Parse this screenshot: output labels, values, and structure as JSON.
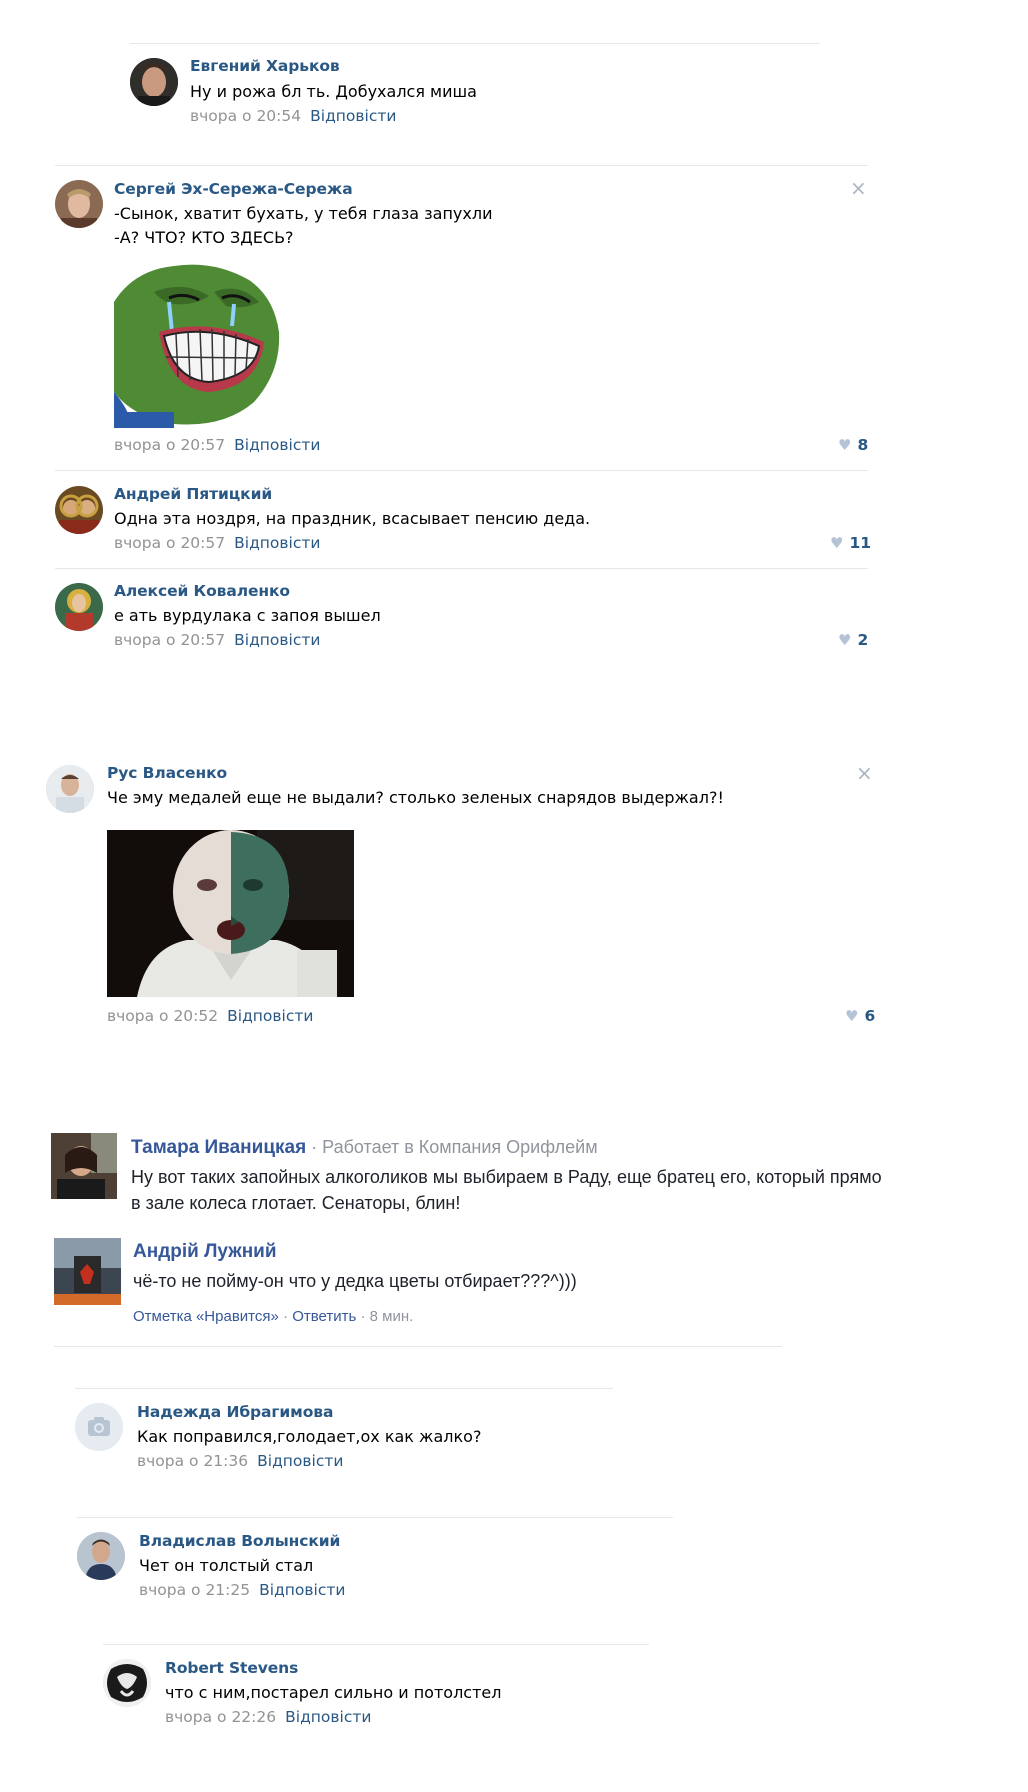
{
  "comments": [
    {
      "author": "Евгений Харьков",
      "text": "Ну и рожа бл ть. Добухался миша",
      "time": "вчора о 20:54",
      "reply": "Відповісти"
    },
    {
      "author": "Сергей Эх-Сережа-Сережа",
      "text1": "-Сынок, хватит бухать, у тебя глаза запухли",
      "text2": "-А? ЧТО? КТО ЗДЕСЬ?",
      "time": "вчора о 20:57",
      "reply": "Відповісти",
      "likes": "8",
      "close": "×",
      "image": "pepe-meme-image"
    },
    {
      "author": "Андрей Пятицкий",
      "text": "Одна эта ноздря, на праздник, всасывает пенсию деда.",
      "time": "вчора о 20:57",
      "reply": "Відповісти",
      "likes": "11"
    },
    {
      "author": "Алексей Коваленко",
      "text": "е ать вурдулака с запоя вышел",
      "time": "вчора о 20:57",
      "reply": "Відповісти",
      "likes": "2"
    },
    {
      "author": "Рус Власенко",
      "text": "Че эму медалей еще не выдали? столько зеленых снарядов выдержал?!",
      "time": "вчора о 20:52",
      "reply": "Відповісти",
      "likes": "6",
      "close": "×",
      "image": "green-face-photo"
    }
  ],
  "fb": [
    {
      "author": "Тамара Иваницкая",
      "subtitle": " · Работает в Компания Орифлейм",
      "text": "Ну вот таких запойных алкоголиков мы выбираем в Раду, еще братец его, который прямо в зале колеса глотает. Сенаторы, блин!"
    },
    {
      "author": "Андрій Лужний",
      "text": "чё-то не пойму-он что у дедка цветы отбирает???^)))",
      "like_label": "Отметка «Нравится»",
      "reply_label": "Ответить",
      "sep": " · ",
      "age": "8 мин."
    }
  ],
  "comments2": [
    {
      "author": "Надежда Ибрагимова",
      "text": "Как поправился,голодает,ох как жалко?",
      "time": "вчора о 21:36",
      "reply": "Відповісти"
    },
    {
      "author": "Владислав Волынский",
      "text": "Чет он толстый стал",
      "time": "вчора о 21:25",
      "reply": "Відповісти"
    },
    {
      "author": "Robert Stevens",
      "text": "что с ним,постарел сильно и потолстел",
      "time": "вчора о 22:26",
      "reply": "Відповісти"
    }
  ],
  "icons": {
    "heart": "♥",
    "camera": "camera-icon"
  },
  "colors": {
    "link": "#2a5885",
    "meta": "#939393",
    "like_heart": "#b4c3d6",
    "fb_link": "#365899"
  }
}
